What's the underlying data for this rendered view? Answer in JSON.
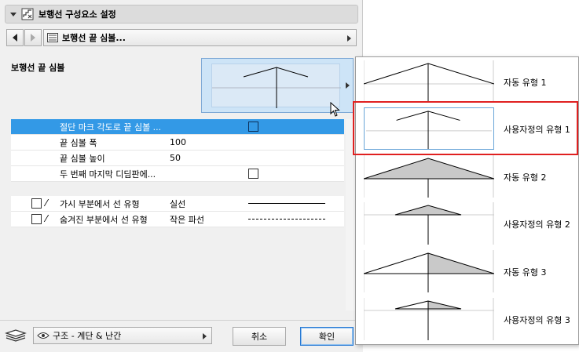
{
  "header": {
    "title": "보행선 구성요소 설정"
  },
  "nav": {
    "selected": "보행선 끝 심볼..."
  },
  "content": {
    "end_symbol_label": "보행선 끝 심볼",
    "properties": [
      {
        "name": "절단 마크 각도로 끝 심볼 ...",
        "value": "",
        "checkbox": true,
        "selected": true
      },
      {
        "name": "끝 심볼 폭",
        "value": "100",
        "checkbox": false,
        "selected": false
      },
      {
        "name": "끝 심볼 높이",
        "value": "50",
        "checkbox": false,
        "selected": false
      },
      {
        "name": "두 번째 마지막 디딤판에...",
        "value": "",
        "checkbox": true,
        "selected": false
      }
    ],
    "lines": [
      {
        "name": "가시 부분에서 선 유형",
        "value": "실선",
        "style": "solid"
      },
      {
        "name": "숨겨진 부분에서 선 유형",
        "value": "작은 파선",
        "style": "dashed"
      }
    ]
  },
  "footer": {
    "layer": "구조 - 계단 & 난간",
    "cancel_label": "취소",
    "ok_label": "확인"
  },
  "popup": {
    "options": [
      {
        "label": "자동 유형 1"
      },
      {
        "label": "사용자정의 유형 1"
      },
      {
        "label": "자동 유형 2"
      },
      {
        "label": "사용자정의 유형 2"
      },
      {
        "label": "자동 유형 3"
      },
      {
        "label": "사용자정의 유형 3"
      }
    ],
    "selected_index": 1
  },
  "colors": {
    "selection_blue": "#3399e6",
    "highlight_red": "#e02020",
    "preview_bg": "#cde4f7"
  }
}
